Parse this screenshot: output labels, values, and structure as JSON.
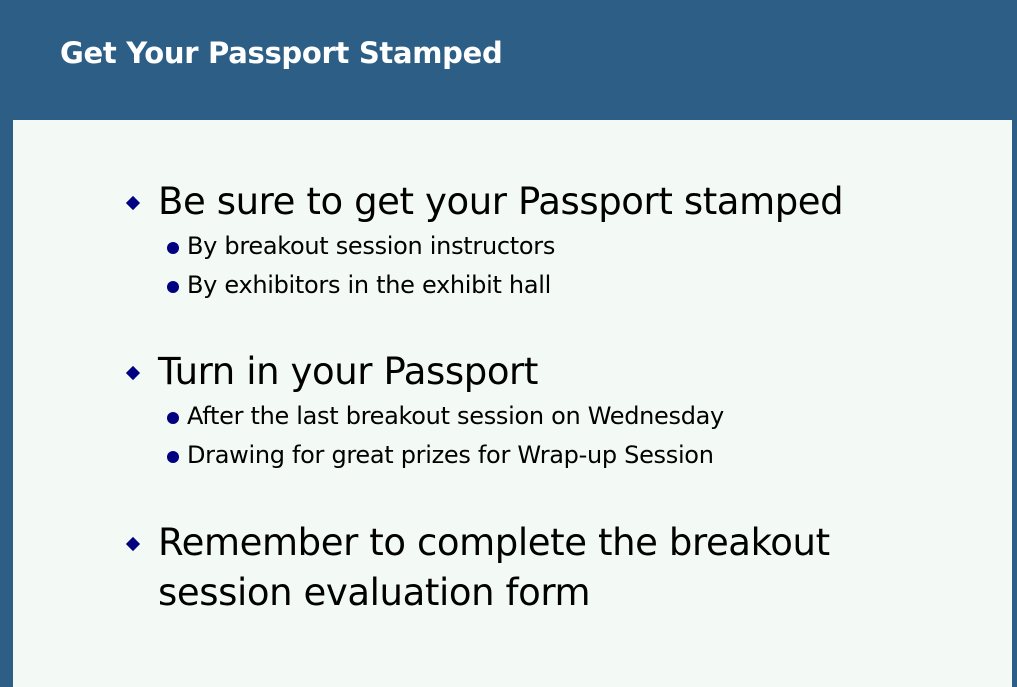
{
  "slide": {
    "title": "Get Your Passport Stamped",
    "bullets": [
      {
        "text": "Be sure to get your Passport stamped",
        "sub": [
          "By breakout session instructors",
          "By exhibitors in the exhibit hall"
        ]
      },
      {
        "text": "Turn in your Passport",
        "sub": [
          "After the last breakout session on Wednesday",
          "Drawing for great prizes for Wrap-up Session"
        ]
      },
      {
        "text": "Remember to complete the breakout session evaluation form",
        "sub": []
      }
    ]
  },
  "colors": {
    "header_background": "#2d5f86",
    "panel_background": "#f3f9f5",
    "bullet_color": "#000080",
    "title_text": "#ffffff"
  },
  "icons": {
    "main_bullet": "diamond-bullet-icon",
    "sub_bullet": "dot-bullet-icon"
  }
}
